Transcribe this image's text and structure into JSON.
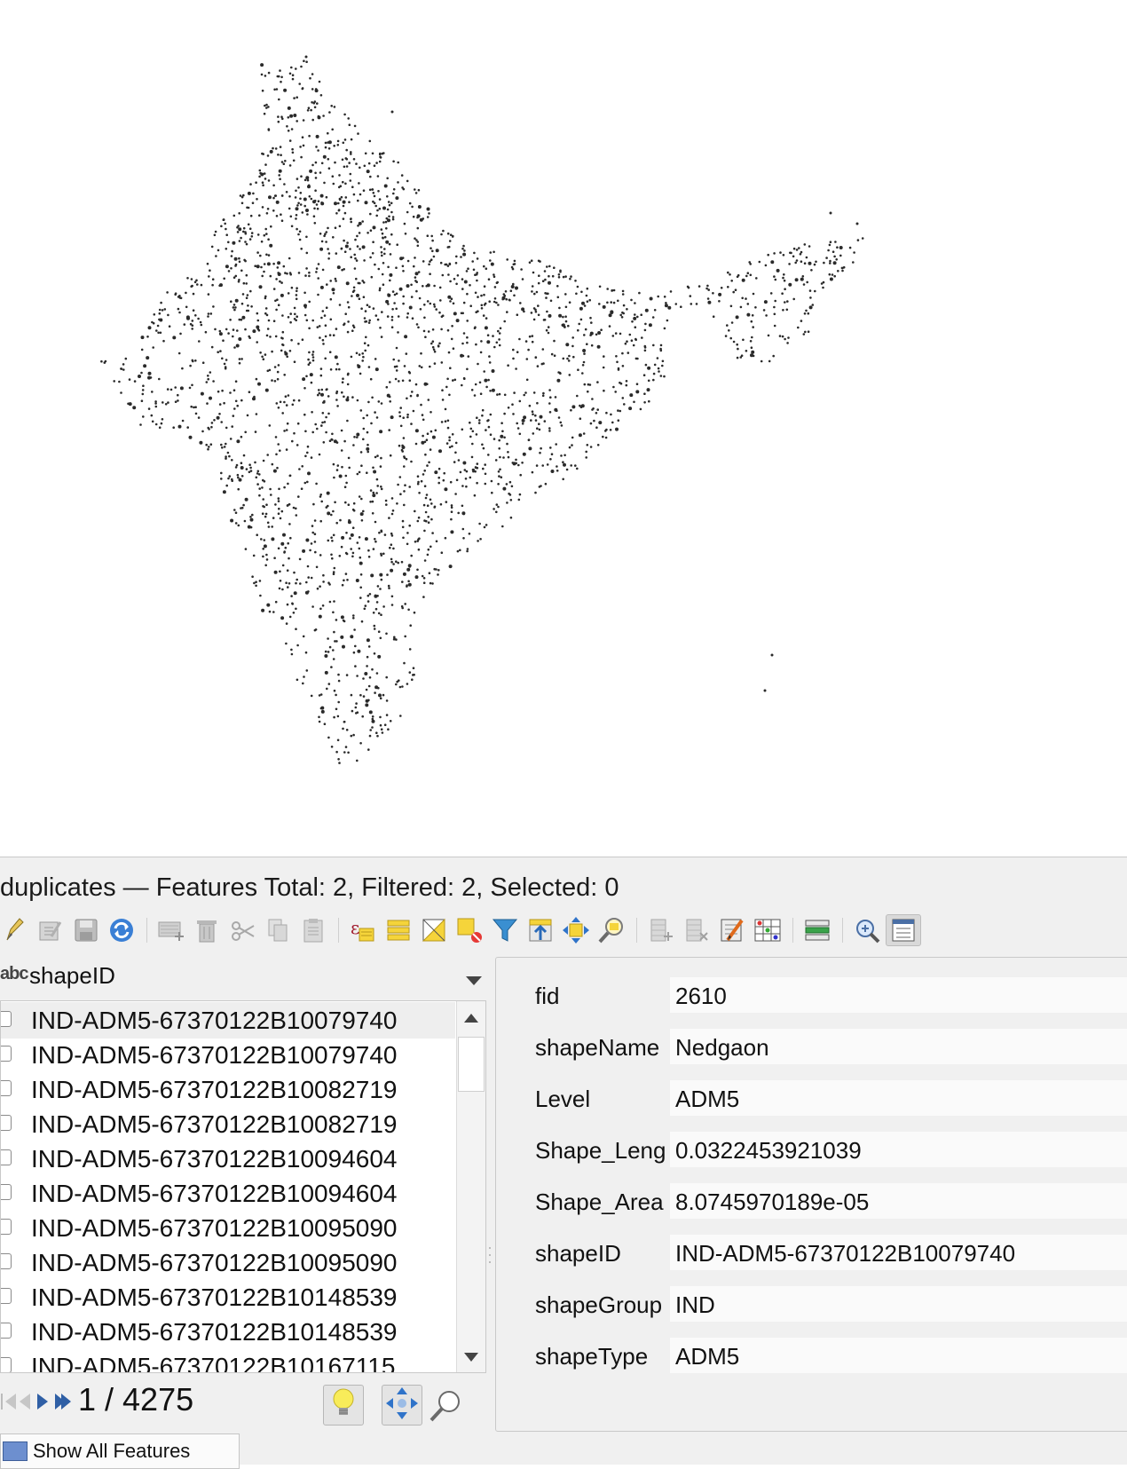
{
  "map": {
    "seed": 7,
    "point_color": "#2a2a2a"
  },
  "panel": {
    "title": "duplicates — Features Total: 2, Filtered: 2, Selected: 0"
  },
  "toolbar": {
    "buttons": [
      {
        "name": "toggle-editing-icon",
        "active": false
      },
      {
        "name": "multi-edit-icon",
        "active": false
      },
      {
        "name": "save-edits-icon",
        "active": false
      },
      {
        "name": "reload-icon",
        "active": false
      },
      {
        "name": "add-feature-icon",
        "active": false
      },
      {
        "name": "delete-feature-icon",
        "active": false
      },
      {
        "name": "cut-icon",
        "active": false
      },
      {
        "name": "copy-icon",
        "active": false
      },
      {
        "name": "paste-icon",
        "active": false
      },
      {
        "name": "select-expression-icon",
        "active": false
      },
      {
        "name": "select-all-icon",
        "active": false
      },
      {
        "name": "invert-selection-icon",
        "active": false
      },
      {
        "name": "deselect-all-icon",
        "active": false
      },
      {
        "name": "filter-icon",
        "active": false
      },
      {
        "name": "move-selection-top-icon",
        "active": false
      },
      {
        "name": "pan-to-selection-icon",
        "active": false
      },
      {
        "name": "zoom-to-selection-icon",
        "active": false
      },
      {
        "name": "new-field-icon",
        "active": false
      },
      {
        "name": "delete-field-icon",
        "active": false
      },
      {
        "name": "field-calculator-icon",
        "active": false
      },
      {
        "name": "conditional-format-icon",
        "active": false
      },
      {
        "name": "actions-icon",
        "active": false
      },
      {
        "name": "dock-icon",
        "active": false
      },
      {
        "name": "form-view-icon",
        "active": true
      }
    ]
  },
  "list": {
    "type_badge": "abc",
    "column": "shapeID",
    "rows": [
      "IND-ADM5-67370122B10079740",
      "IND-ADM5-67370122B10079740",
      "IND-ADM5-67370122B10082719",
      "IND-ADM5-67370122B10082719",
      "IND-ADM5-67370122B10094604",
      "IND-ADM5-67370122B10094604",
      "IND-ADM5-67370122B10095090",
      "IND-ADM5-67370122B10095090",
      "IND-ADM5-67370122B10148539",
      "IND-ADM5-67370122B10148539",
      "IND-ADM5-67370122B10167115"
    ]
  },
  "nav": {
    "counter": "1 / 4275"
  },
  "bottom_tab": {
    "label": "Show All Features"
  },
  "form": {
    "fields": [
      {
        "label": "fid",
        "value": "2610"
      },
      {
        "label": "shapeName",
        "value": "Nedgaon"
      },
      {
        "label": "Level",
        "value": "ADM5"
      },
      {
        "label": "Shape_Leng",
        "value": "0.0322453921039"
      },
      {
        "label": "Shape_Area",
        "value": "8.0745970189e-05"
      },
      {
        "label": "shapeID",
        "value": "IND-ADM5-67370122B10079740"
      },
      {
        "label": "shapeGroup",
        "value": "IND"
      },
      {
        "label": "shapeType",
        "value": "ADM5"
      }
    ]
  }
}
